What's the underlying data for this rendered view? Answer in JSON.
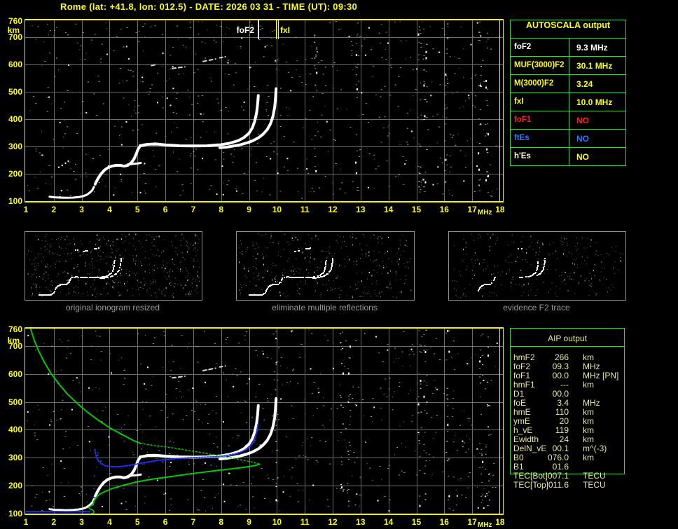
{
  "title": "Rome (lat: +41.8, lon: 012.5) - DATE: 2026 03 31 - TIME (UT): 09:30",
  "colors": {
    "background": "#000000",
    "axis_yellow": "#ffff00",
    "border_yellow": "#f0f000",
    "grid_gray": "#6c6c6c",
    "table_green": "#44cc44",
    "aip_text": "#e9e99c",
    "caption_gray": "#9a9a9a",
    "trace_white": "#ffffff",
    "model_blue": "#2233ff",
    "profile_green": "#00cc00",
    "alert_red": "#ff2222",
    "es_blue": "#2a7cff"
  },
  "axes": {
    "x_ticks": [
      "1",
      "2",
      "3",
      "4",
      "5",
      "6",
      "7",
      "8",
      "9",
      "10",
      "11",
      "12",
      "13",
      "14",
      "15",
      "16",
      "17",
      "18"
    ],
    "x_unit": "MHz",
    "y_ticks": [
      "760",
      "700",
      "600",
      "500",
      "400",
      "300",
      "200",
      "100"
    ],
    "y_unit": "km"
  },
  "autoscala": {
    "header": "AUTOSCALA output",
    "rows": [
      {
        "label": "foF2",
        "value": "9.3 MHz",
        "color": "#ffffff"
      },
      {
        "label": "MUF(3000)F2",
        "value": "30.1 MHz",
        "color": "#ffff00"
      },
      {
        "label": "M(3000)F2",
        "value": "3.24",
        "color": "#ffff00"
      },
      {
        "label": "fxI",
        "value": "10.0 MHz",
        "color": "#ffff00"
      },
      {
        "label": "foF1",
        "value": "NO",
        "color": "#ff2222"
      },
      {
        "label": "ftEs",
        "value": "NO",
        "color": "#2a7cff"
      },
      {
        "label": "h'Es",
        "value": "NO",
        "color": "#ffff00",
        "label_color": "#ffffcc"
      }
    ]
  },
  "aip": {
    "header": "AIP output",
    "rows": [
      {
        "label": "hmF2",
        "value": "266",
        "unit": "km",
        "note": ""
      },
      {
        "label": "foF2",
        "value": "09.3",
        "unit": "MHz",
        "note": ""
      },
      {
        "label": "foF1",
        "value": "00.0",
        "unit": "MHz",
        "note": "[PN]"
      },
      {
        "label": "hmF1",
        "value": "---",
        "unit": "km",
        "note": ""
      },
      {
        "label": "D1",
        "value": "00.0",
        "unit": "",
        "note": ""
      },
      {
        "label": "foE",
        "value": "3.4",
        "unit": "MHz",
        "note": ""
      },
      {
        "label": "hmE",
        "value": "110",
        "unit": "km",
        "note": ""
      },
      {
        "label": "ymE",
        "value": "20",
        "unit": "km",
        "note": ""
      },
      {
        "label": "h_vE",
        "value": "119",
        "unit": "km",
        "note": ""
      },
      {
        "label": "Ewidth",
        "value": "24",
        "unit": "km",
        "note": ""
      },
      {
        "label": "DelN_vE",
        "value": "00.1",
        "unit": "m^(-3)",
        "note": ""
      },
      {
        "label": "B0",
        "value": "076.0",
        "unit": "km",
        "note": ""
      },
      {
        "label": "B1",
        "value": "01.6",
        "unit": "",
        "note": ""
      },
      {
        "label": "TEC[Bot]",
        "value": "007.1",
        "unit": "TECU",
        "note": ""
      },
      {
        "label": "TEC[Top]",
        "value": "011.6",
        "unit": "TECU",
        "note": ""
      }
    ]
  },
  "thumbnails": [
    {
      "caption": "original ionogram resized",
      "noise": {
        "seed": 5,
        "density": 500
      },
      "series": [
        {
          "name": "E-trace"
        },
        {
          "name": "F1-trace"
        },
        {
          "name": "F2-O-trace"
        },
        {
          "name": "F2-X-trace"
        },
        {
          "name": "second-hop-echo"
        },
        {
          "name": "second-hop-echo-2"
        },
        {
          "name": "second-hop-echo-3"
        }
      ]
    },
    {
      "caption": "eliminate multiple reflections",
      "noise": {
        "seed": 6,
        "density": 360
      },
      "series": [
        {
          "name": "E-trace"
        },
        {
          "name": "F1-trace"
        },
        {
          "name": "F2-O-trace"
        },
        {
          "name": "F2-X-trace"
        },
        {
          "name": "second-hop-echo-2"
        },
        {
          "name": "second-hop-echo-3"
        }
      ]
    },
    {
      "caption": "evidence F2 trace",
      "noise": {
        "seed": 7,
        "density": 260
      },
      "series": [
        {
          "name": "F1-trace",
          "skip": 0.45
        },
        {
          "name": "F2-O-trace",
          "min_f": 8.0
        },
        {
          "name": "F2-X-trace",
          "min_f": 9.2
        },
        {
          "name": "second-hop-echo-3"
        }
      ]
    }
  ],
  "chart_data": [
    {
      "id": "autoscala-ionogram",
      "type": "scatter",
      "title": "",
      "xlabel": "MHz",
      "ylabel": "km",
      "xlim": [
        1,
        18
      ],
      "ylim": [
        100,
        760
      ],
      "grid": true,
      "series": [
        {
          "name": "E-trace",
          "color": "#ffffff",
          "width": 3,
          "points": [
            [
              1.85,
              116
            ],
            [
              2.0,
              114
            ],
            [
              2.2,
              113
            ],
            [
              2.45,
              112
            ],
            [
              2.7,
              113
            ],
            [
              2.9,
              115
            ],
            [
              3.05,
              118
            ],
            [
              3.18,
              123
            ],
            [
              3.28,
              130
            ],
            [
              3.38,
              140
            ],
            [
              3.44,
              152
            ]
          ]
        },
        {
          "name": "F1-trace",
          "color": "#ffffff",
          "width": 4,
          "points": [
            [
              3.48,
              162
            ],
            [
              3.58,
              182
            ],
            [
              3.68,
              198
            ],
            [
              3.8,
              212
            ],
            [
              3.93,
              222
            ],
            [
              4.08,
              228
            ],
            [
              4.22,
              231
            ],
            [
              4.38,
              231
            ],
            [
              4.52,
              228
            ],
            [
              4.65,
              231
            ],
            [
              4.78,
              241
            ],
            [
              4.88,
              255
            ],
            [
              4.95,
              272
            ],
            [
              5.02,
              290
            ],
            [
              5.1,
              303
            ]
          ]
        },
        {
          "name": "F2-O-trace",
          "color": "#ffffff",
          "width": 4,
          "points": [
            [
              5.1,
              303
            ],
            [
              5.35,
              308
            ],
            [
              5.65,
              309
            ],
            [
              6.0,
              306
            ],
            [
              6.5,
              303
            ],
            [
              7.0,
              302
            ],
            [
              7.5,
              303
            ],
            [
              8.0,
              307
            ],
            [
              8.3,
              312
            ],
            [
              8.6,
              321
            ],
            [
              8.82,
              333
            ],
            [
              9.0,
              349
            ],
            [
              9.12,
              369
            ],
            [
              9.2,
              392
            ],
            [
              9.27,
              423
            ],
            [
              9.31,
              458
            ],
            [
              9.33,
              487
            ]
          ]
        },
        {
          "name": "F2-X-trace",
          "color": "#ffffff",
          "width": 4,
          "points": [
            [
              7.95,
              296
            ],
            [
              8.2,
              298
            ],
            [
              8.45,
              302
            ],
            [
              8.7,
              307
            ],
            [
              8.95,
              314
            ],
            [
              9.15,
              322
            ],
            [
              9.35,
              333
            ],
            [
              9.5,
              345
            ],
            [
              9.65,
              362
            ],
            [
              9.77,
              384
            ],
            [
              9.86,
              412
            ],
            [
              9.92,
              445
            ],
            [
              9.95,
              478
            ],
            [
              9.97,
              512
            ]
          ]
        },
        {
          "name": "F1-X-cusp",
          "color": "#ffffff",
          "width": 3,
          "points": [
            [
              4.65,
              234
            ],
            [
              4.82,
              236
            ],
            [
              5.0,
              238
            ],
            [
              5.12,
              240
            ]
          ]
        },
        {
          "name": "E-echo-dots",
          "color": "#ffffff",
          "width": 2,
          "dots": true,
          "points": [
            [
              2.18,
              224
            ],
            [
              2.3,
              231
            ],
            [
              2.42,
              239
            ],
            [
              2.52,
              246
            ]
          ]
        },
        {
          "name": "second-hop-echo",
          "color": "#d8d8d8",
          "width": 2,
          "dash": [
            5,
            4
          ],
          "points": [
            [
              5.5,
              597
            ],
            [
              5.7,
              601
            ]
          ]
        },
        {
          "name": "second-hop-echo-2",
          "color": "#d8d8d8",
          "width": 2,
          "dash": [
            5,
            4
          ],
          "points": [
            [
              6.25,
              586
            ],
            [
              6.7,
              592
            ]
          ]
        },
        {
          "name": "second-hop-echo-3",
          "color": "#d8d8d8",
          "width": 2,
          "dash": [
            5,
            4
          ],
          "points": [
            [
              7.35,
              612
            ],
            [
              7.8,
              621
            ]
          ]
        },
        {
          "name": "second-hop-echo-4",
          "color": "#d8d8d8",
          "width": 2,
          "dash": [
            4,
            4
          ],
          "points": [
            [
              7.95,
              625
            ],
            [
              8.15,
              629
            ]
          ]
        }
      ],
      "markers": [
        {
          "label": "foF2",
          "freq": 9.32,
          "color": "#ffffff"
        },
        {
          "label": "fxI",
          "freq": 10.0,
          "color": "#ffff00"
        }
      ],
      "noise": {
        "seed": 20,
        "density": 650,
        "columns": [
          11.35,
          12.85,
          15.1,
          15.3,
          16.05,
          17.25,
          17.5
        ]
      }
    },
    {
      "id": "aip-profile-ionogram",
      "type": "scatter",
      "title": "",
      "xlabel": "MHz",
      "ylabel": "km",
      "xlim": [
        1,
        18
      ],
      "ylim": [
        100,
        760
      ],
      "grid": true,
      "inherit_series_from": 0,
      "inherit": [
        "E-trace",
        "F1-trace",
        "F2-O-trace",
        "F2-X-trace",
        "F1-X-cusp",
        "second-hop-echo-2",
        "second-hop-echo-3",
        "second-hop-echo-4"
      ],
      "series": [
        {
          "name": "model-E-trace",
          "color": "#2233ff",
          "width": 2,
          "dash": [
            2,
            2
          ],
          "points": [
            [
              1.02,
              107
            ],
            [
              3.32,
              107
            ]
          ]
        },
        {
          "name": "model-jump-points",
          "color": "#2233ff",
          "width": 2,
          "dots": true,
          "points": [
            [
              3.4,
              130
            ],
            [
              3.42,
              160
            ],
            [
              3.44,
              190
            ],
            [
              3.46,
              235
            ]
          ]
        },
        {
          "name": "model-F-trace",
          "color": "#2233ff",
          "width": 2,
          "dash": [
            2,
            2
          ],
          "points": [
            [
              3.47,
              330
            ],
            [
              3.5,
              314
            ],
            [
              3.54,
              301
            ],
            [
              3.6,
              289
            ],
            [
              3.68,
              281
            ],
            [
              3.78,
              274
            ],
            [
              3.9,
              270
            ],
            [
              4.1,
              268
            ],
            [
              4.35,
              268
            ],
            [
              4.6,
              271
            ],
            [
              4.85,
              275
            ],
            [
              5.1,
              280
            ],
            [
              5.4,
              285
            ],
            [
              5.7,
              290
            ],
            [
              6.0,
              293
            ],
            [
              6.4,
              297
            ],
            [
              6.9,
              300
            ],
            [
              7.4,
              302
            ],
            [
              7.9,
              304
            ],
            [
              8.2,
              308
            ],
            [
              8.5,
              314
            ],
            [
              8.75,
              322
            ],
            [
              8.95,
              333
            ],
            [
              9.1,
              348
            ],
            [
              9.2,
              367
            ],
            [
              9.28,
              394
            ],
            [
              9.32,
              420
            ]
          ]
        },
        {
          "name": "profile-topside",
          "color": "#00cc00",
          "width": 2,
          "points": [
            [
              1.15,
              768
            ],
            [
              1.28,
              726
            ],
            [
              1.45,
              684
            ],
            [
              1.65,
              644
            ],
            [
              1.9,
              602
            ],
            [
              2.2,
              562
            ],
            [
              2.5,
              527
            ],
            [
              2.85,
              494
            ],
            [
              3.2,
              464
            ],
            [
              3.6,
              434
            ],
            [
              4.0,
              408
            ],
            [
              4.45,
              383
            ],
            [
              4.85,
              362
            ],
            [
              5.1,
              352
            ]
          ]
        },
        {
          "name": "profile-topside-dotted",
          "color": "#00cc00",
          "width": 1.5,
          "dash": [
            2,
            3
          ],
          "points": [
            [
              5.1,
              352
            ],
            [
              5.6,
              344
            ],
            [
              6.1,
              338
            ],
            [
              6.6,
              330
            ],
            [
              7.1,
              322
            ],
            [
              7.6,
              313
            ],
            [
              8.1,
              304
            ],
            [
              8.6,
              295
            ],
            [
              9.0,
              287
            ],
            [
              9.25,
              281
            ],
            [
              9.38,
              277
            ]
          ]
        },
        {
          "name": "profile-bottomside",
          "color": "#00cc00",
          "width": 2,
          "points": [
            [
              9.38,
              277
            ],
            [
              9.2,
              272
            ],
            [
              8.9,
              267
            ],
            [
              8.5,
              262
            ],
            [
              8.0,
              256
            ],
            [
              7.5,
              250
            ],
            [
              7.0,
              244
            ],
            [
              6.5,
              237
            ],
            [
              6.0,
              230
            ],
            [
              5.5,
              223
            ],
            [
              5.0,
              214
            ],
            [
              4.5,
              202
            ],
            [
              4.1,
              190
            ],
            [
              3.85,
              180
            ],
            [
              3.65,
              170
            ],
            [
              3.52,
              158
            ],
            [
              3.44,
              145
            ],
            [
              3.41,
              133
            ]
          ]
        },
        {
          "name": "profile-E-hook",
          "color": "#00cc00",
          "width": 1.5,
          "points": [
            [
              3.41,
              133
            ],
            [
              3.32,
              127
            ],
            [
              3.24,
              122
            ],
            [
              3.3,
              117
            ],
            [
              3.4,
              112
            ],
            [
              3.44,
              107
            ],
            [
              3.42,
              102
            ],
            [
              3.36,
              100
            ]
          ]
        }
      ],
      "markers": [],
      "noise": {
        "seed": 77,
        "density": 620,
        "columns": [
          9.95,
          12.3,
          12.55,
          15.1,
          15.3,
          16.1,
          17.3,
          17.55
        ]
      }
    }
  ]
}
